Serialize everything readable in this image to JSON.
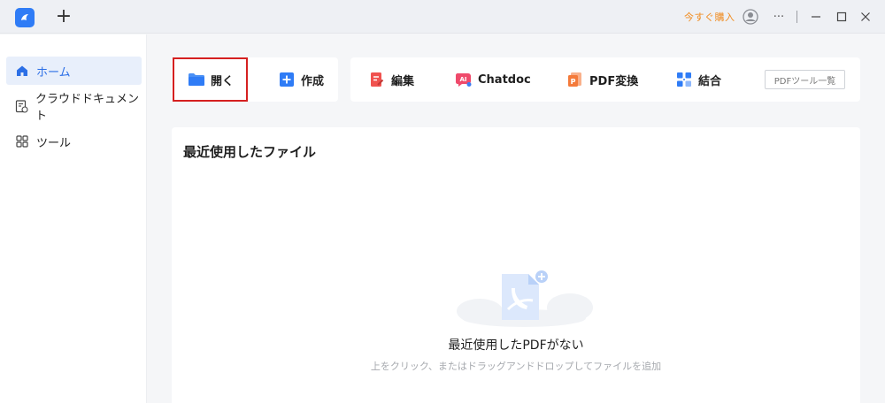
{
  "titlebar": {
    "new_tab_label": "+",
    "upgrade_label": "今すぐ購入",
    "more_label": "···"
  },
  "sidebar": {
    "items": [
      {
        "label": "ホーム",
        "icon": "home-icon",
        "active": true
      },
      {
        "label": "クラウドドキュメント",
        "icon": "cloud-document-icon",
        "active": false
      },
      {
        "label": "ツール",
        "icon": "tools-grid-icon",
        "active": false
      }
    ]
  },
  "toolbar": {
    "open_label": "開く",
    "create_label": "作成",
    "edit_label": "編集",
    "chatdoc_label": "Chatdoc",
    "convert_label": "PDF変換",
    "combine_label": "結合",
    "pdf_tools_label": "PDFツール一覧"
  },
  "recent": {
    "title": "最近使用したファイル",
    "empty_title": "最近使用したPDFがない",
    "empty_subtitle": "上をクリック、またはドラッグアンドドロップしてファイルを追加"
  },
  "colors": {
    "accent": "#2f7cf6",
    "upgrade": "#f08a1c",
    "highlight": "#d52020",
    "edit_icon": "#f0524f",
    "convert_icon": "#f47a3a"
  }
}
